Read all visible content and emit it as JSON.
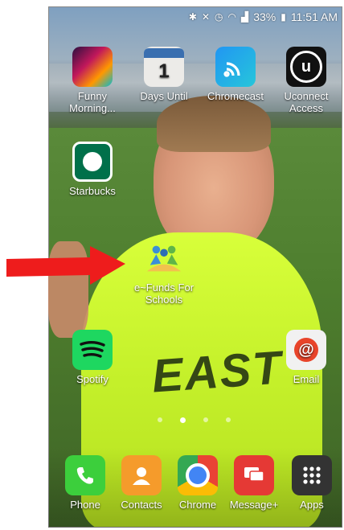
{
  "status_bar": {
    "battery": "33%",
    "time": "11:51 AM",
    "icons": [
      "bluetooth-icon",
      "mute-icon",
      "alarm-icon",
      "wifi-icon",
      "lte-icon",
      "signal-icon",
      "battery-icon"
    ]
  },
  "home": {
    "row1": [
      {
        "label": "Funny Morning...",
        "icon": "funny-morning-icon"
      },
      {
        "label": "Days Until",
        "icon": "calendar-icon",
        "day": "1"
      },
      {
        "label": "Chromecast",
        "icon": "chromecast-icon"
      },
      {
        "label": "Uconnect Access",
        "icon": "uconnect-icon"
      }
    ],
    "starbucks": {
      "label": "Starbucks",
      "icon": "starbucks-icon"
    },
    "efunds": {
      "label": "e~Funds For Schools",
      "icon": "efunds-icon"
    },
    "spotify": {
      "label": "Spotify",
      "icon": "spotify-icon"
    },
    "email": {
      "label": "Email",
      "icon": "email-icon"
    },
    "wallpaper_text": "EAST",
    "page_indicator": {
      "pages": 4,
      "active": 2
    }
  },
  "dock": [
    {
      "label": "Phone",
      "icon": "phone-icon"
    },
    {
      "label": "Contacts",
      "icon": "contacts-icon"
    },
    {
      "label": "Chrome",
      "icon": "chrome-icon"
    },
    {
      "label": "Message+",
      "icon": "message-icon"
    },
    {
      "label": "Apps",
      "icon": "apps-grid-icon"
    }
  ],
  "colors": {
    "arrow": "#ee1c1c",
    "shirt": "#c8f22c"
  }
}
